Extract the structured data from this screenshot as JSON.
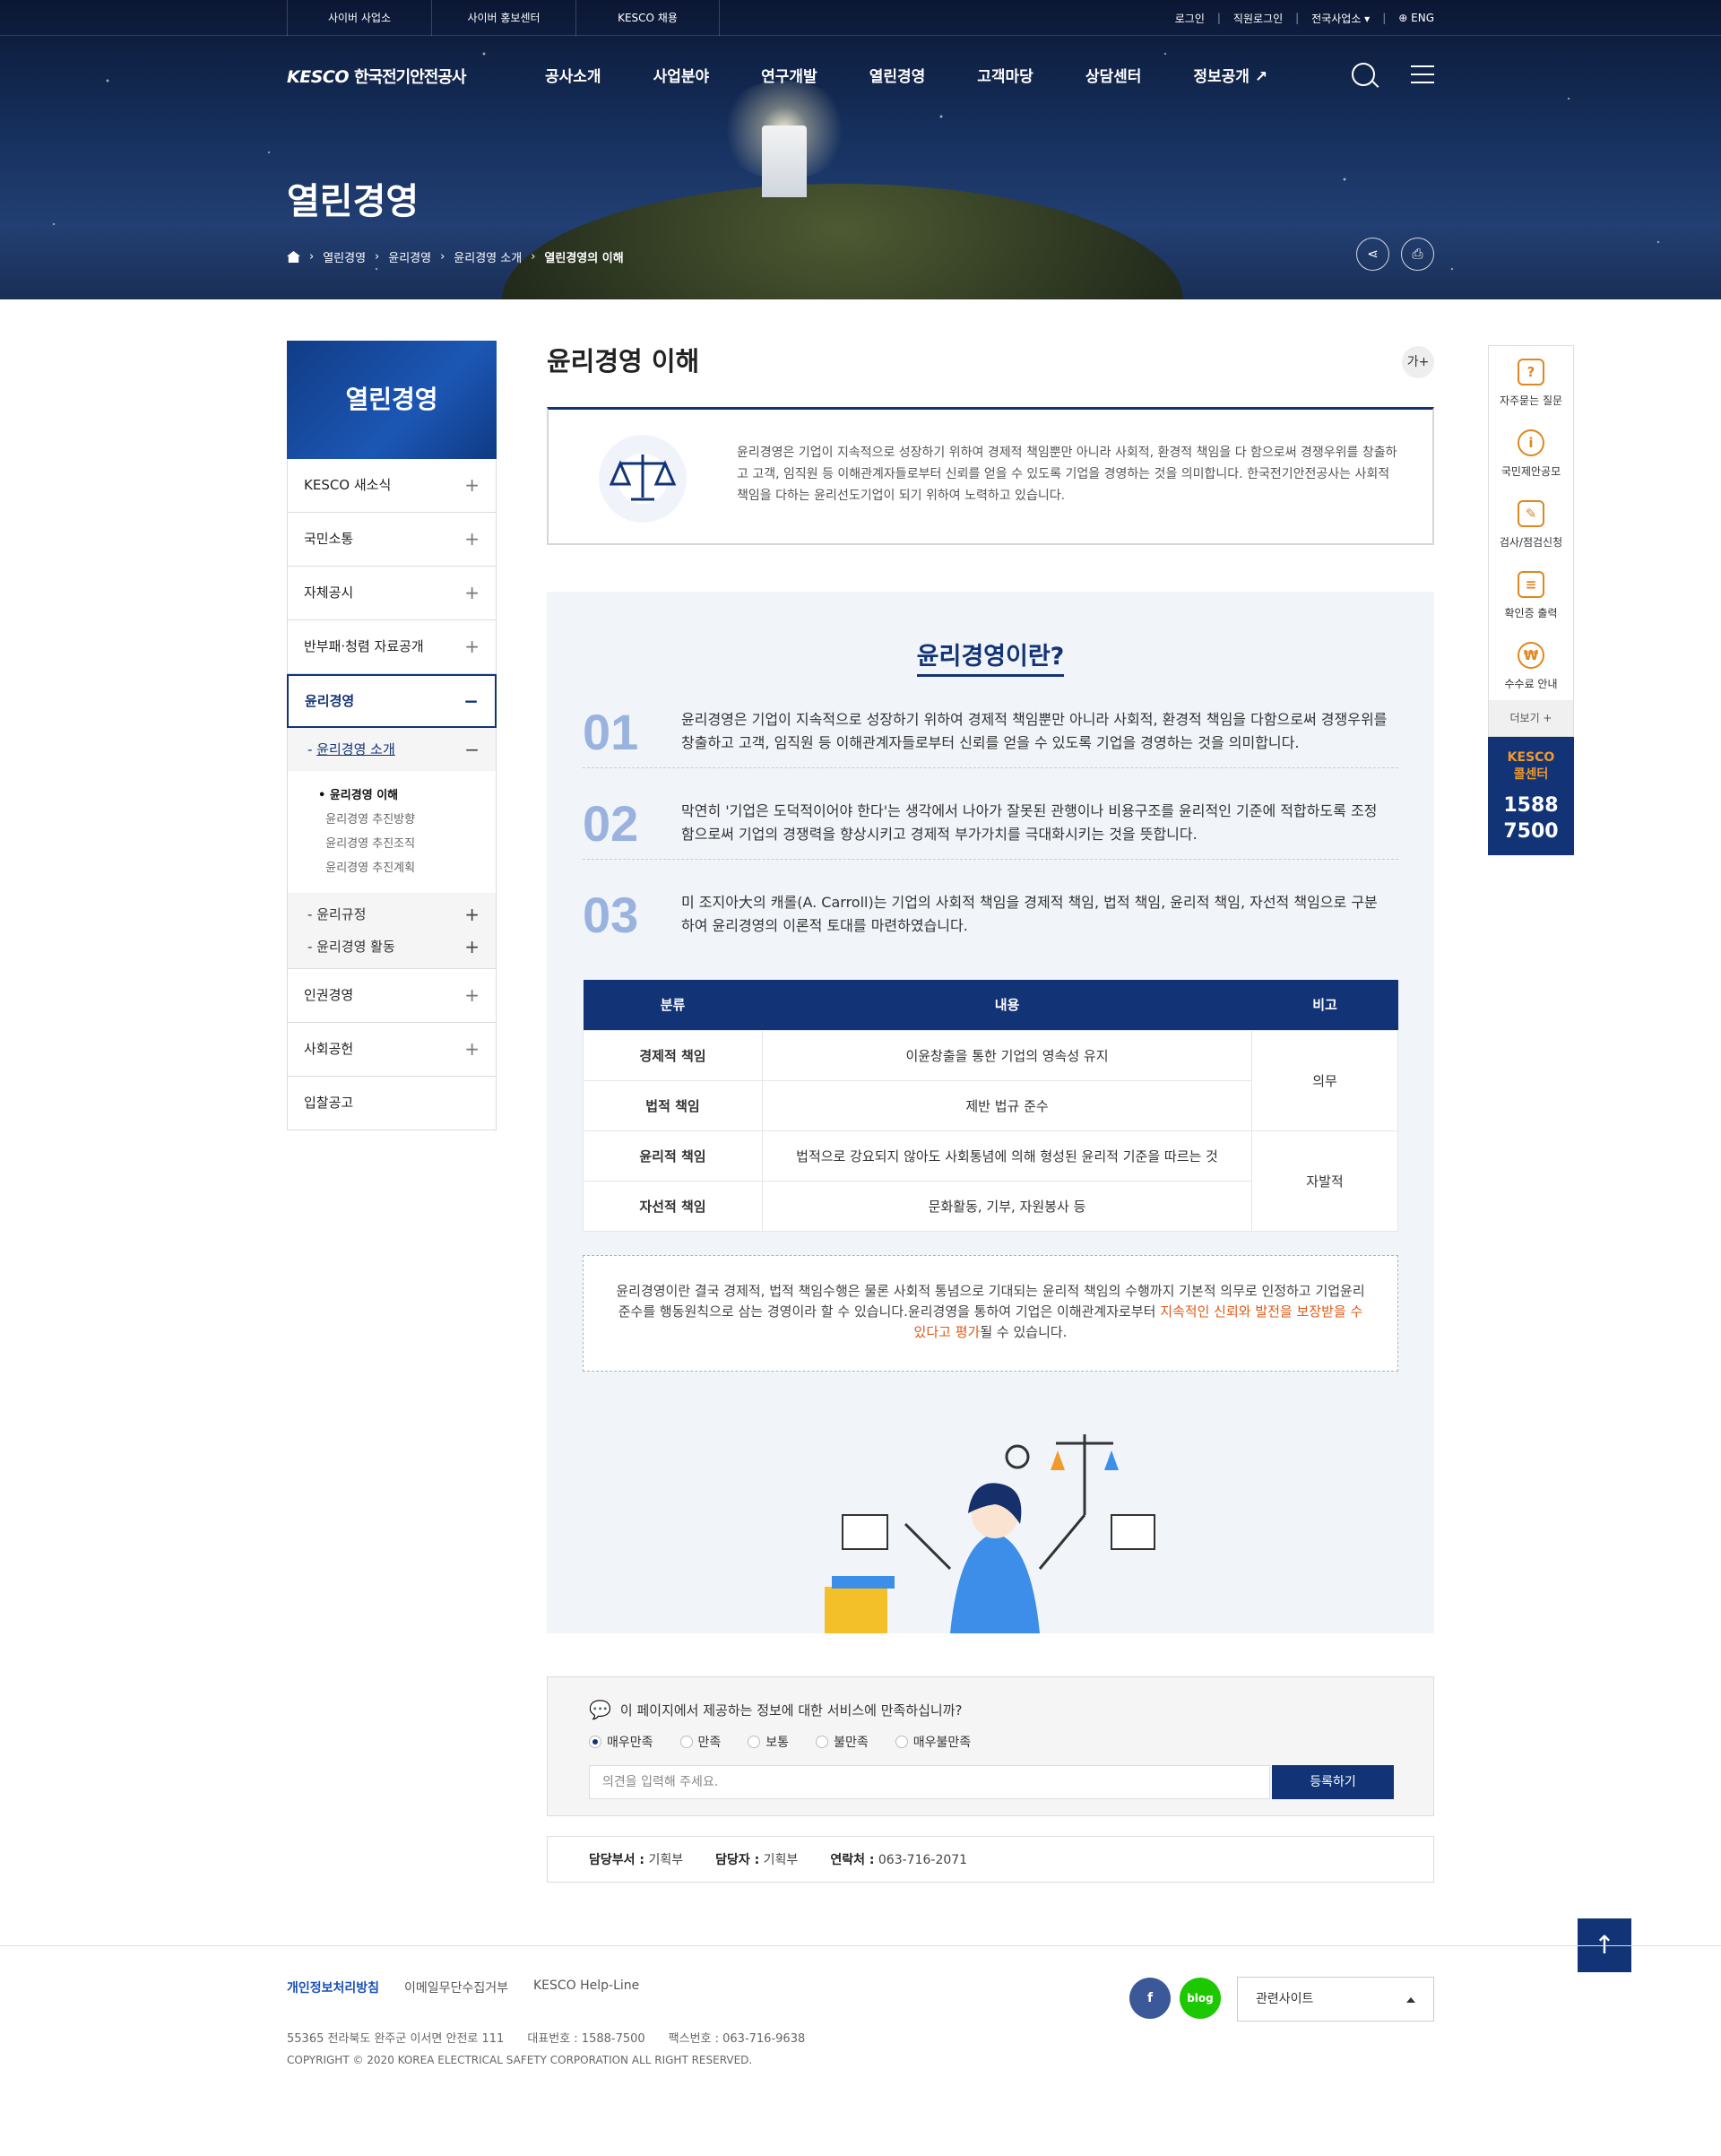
{
  "topbar": {
    "links": [
      "사이버 사업소",
      "사이버 홍보센터",
      "KESCO 채용"
    ],
    "right": [
      "로그인",
      "직원로그인",
      "전국사업소",
      "ENG"
    ]
  },
  "header": {
    "logo": "KESCO",
    "logo_sub": "한국전기안전공사",
    "menu": [
      "공사소개",
      "사업분야",
      "연구개발",
      "열린경영",
      "고객마당",
      "상담센터",
      "정보공개"
    ]
  },
  "hero": {
    "title": "열린경영",
    "breadcrumb": [
      "열린경영",
      "윤리경영",
      "윤리경영 소개",
      "열린경영의 이해"
    ]
  },
  "lnb": {
    "title": "열린경영",
    "items": [
      "KESCO 새소식",
      "국민소통",
      "자체공시",
      "반부패·청렴 자료공개",
      "윤리경영"
    ],
    "sub_title": "윤리경영 소개",
    "sub3": [
      "윤리경영 이해",
      "윤리경영 추진방향",
      "윤리경영 추진조직",
      "윤리경영 추진계획"
    ],
    "sub2": [
      "윤리규정",
      "윤리경영 활동"
    ],
    "items_after": [
      "인권경영",
      "사회공헌",
      "입찰공고"
    ]
  },
  "page": {
    "title": "윤리경영 이해",
    "font_btn": "가+",
    "intro": "윤리경영은 기업이 지속적으로 성장하기 위하여 경제적 책임뿐만 아니라 사회적, 환경적 책임을 다 함으로써 경쟁우위를 창출하고 고객, 임직원 등 이해관계자들로부터 신뢰를 얻을 수 있도록 기업을 경영하는 것을 의미합니다. 한국전기안전공사는 사회적 책임을 다하는 윤리선도기업이 되기 위하여 노력하고 있습니다.",
    "section_title": "윤리경영이란?",
    "points": [
      {
        "n": "01",
        "text": "윤리경영은 기업이 지속적으로 성장하기 위하여 경제적 책임뿐만 아니라 사회적, 환경적 책임을 다함으로써 경쟁우위를 창출하고 고객, 임직원 등 이해관계자들로부터 신뢰를 얻을 수 있도록 기업을 경영하는 것을 의미합니다."
      },
      {
        "n": "02",
        "text": "막연히 '기업은 도덕적이어야 한다'는 생각에서 나아가 잘못된 관행이나 비용구조를 윤리적인 기준에 적합하도록 조정함으로써 기업의 경쟁력을 향상시키고 경제적 부가가치를 극대화시키는 것을 뜻합니다."
      },
      {
        "n": "03",
        "text": "미 조지아大의 캐롤(A. Carroll)는 기업의 사회적 책임을 경제적 책임, 법적 책임, 윤리적 책임, 자선적 책임으로 구분하여 윤리경영의 이론적 토대를 마련하였습니다."
      }
    ],
    "table": {
      "headers": [
        "분류",
        "내용",
        "비고"
      ],
      "rows": [
        [
          "경제적 책임",
          "이윤창출을 통한 기업의 영속성 유지"
        ],
        [
          "법적 책임",
          "제반 법규 준수"
        ],
        [
          "윤리적 책임",
          "법적으로 강요되지 않아도 사회통념에 의해 형성된 윤리적 기준을 따르는 것"
        ],
        [
          "자선적 책임",
          "문화활동, 기부, 자원봉사 등"
        ]
      ],
      "notes": [
        "의무",
        "자발적"
      ]
    },
    "note_a": "윤리경영이란 결국 경제적, 법적 책임수행은 물론 사회적 통념으로 기대되는 윤리적 책임의 수행까지 기본적 의무로 인정하고 기업윤리 준수를 행동원칙으로 삼는 경영이라 할 수 있습니다.윤리경영을 통하여 기업은 이해관계자로부터 ",
    "note_hl": "지속적인 신뢰와 발전을 보장받을 수 있다고 평가",
    "note_b": "될 수 있습니다."
  },
  "survey": {
    "question": "이 페이지에서 제공하는 정보에 대한 서비스에 만족하십니까?",
    "options": [
      "매우만족",
      "만족",
      "보통",
      "불만족",
      "매우불만족"
    ],
    "placeholder": "의견을 입력해 주세요.",
    "submit": "등록하기"
  },
  "manager": {
    "dept_label": "담당부서 :",
    "dept": "기획부",
    "person_label": "담당자 :",
    "person": "기획부",
    "contact_label": "연락처 :",
    "contact": "063-716-2071"
  },
  "quick": {
    "items": [
      "자주묻는 질문",
      "국민제안공모",
      "검사/점검신청",
      "확인증 출력",
      "수수료 안내"
    ],
    "more": "더보기 +",
    "cc_title1": "KESCO",
    "cc_title2": "콜센터",
    "cc_num1": "1588",
    "cc_num2": "7500"
  },
  "footer": {
    "links": [
      "개인정보처리방침",
      "이메일무단수집거부",
      "KESCO Help-Line"
    ],
    "address": "55365 전라북도 완주군 이서면 안전로 111",
    "tel": "대표번호 : 1588-7500",
    "fax": "팩스번호 : 063-716-9638",
    "copyright": "COPYRIGHT © 2020 KOREA ELECTRICAL SAFETY CORPORATION ALL RIGHT RESERVED.",
    "related": "관련사이트",
    "facebook": "f",
    "blog": "blog"
  },
  "colors": {
    "primary": "#123477",
    "accent": "#e05a17"
  }
}
